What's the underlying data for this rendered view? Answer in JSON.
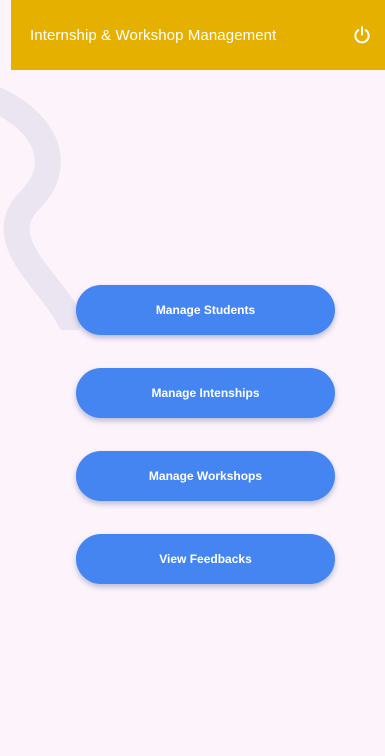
{
  "app_bar": {
    "title": "Internship & Workshop Management",
    "background_color": "#e6b000",
    "logout_icon": "power-icon"
  },
  "menu": {
    "buttons": [
      {
        "label": "Manage Students"
      },
      {
        "label": "Manage Intenships"
      },
      {
        "label": "Manage Workshops"
      },
      {
        "label": "View Feedbacks"
      }
    ],
    "button_color": "#4485f2"
  },
  "theme": {
    "page_background": "#fdf4fb"
  }
}
